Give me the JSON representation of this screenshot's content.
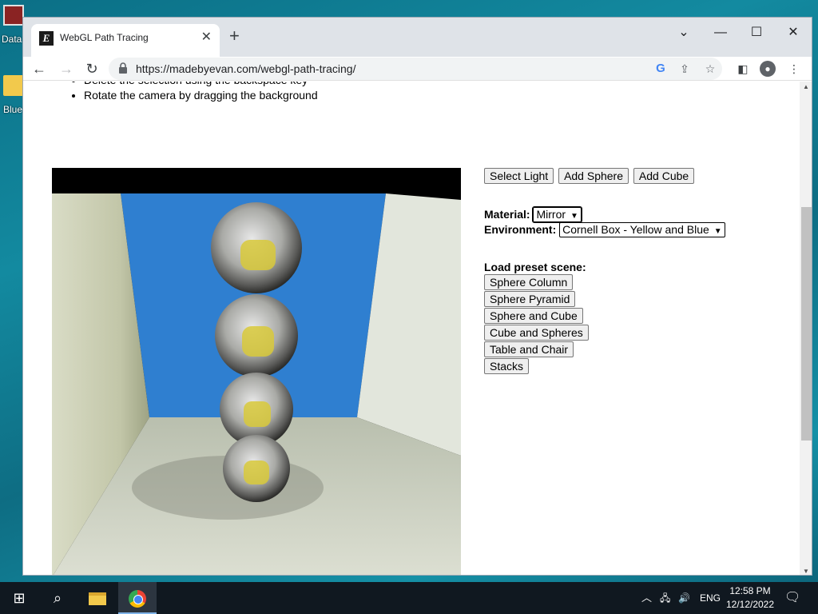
{
  "desktop": {
    "icons": [
      {
        "label": "Data"
      },
      {
        "label": "Blue"
      }
    ]
  },
  "browser": {
    "tab_title": "WebGL Path Tracing",
    "tab_favicon_letter": "E",
    "url": "https://madebyevan.com/webgl-path-tracing/"
  },
  "page": {
    "tips": [
      "Delete the selection using the backspace key",
      "Rotate the camera by dragging the background"
    ],
    "buttons": {
      "select_light": "Select Light",
      "add_sphere": "Add Sphere",
      "add_cube": "Add Cube"
    },
    "material_label": "Material:",
    "material_value": "Mirror",
    "environment_label": "Environment:",
    "environment_value": "Cornell Box - Yellow and Blue",
    "preset_label": "Load preset scene:",
    "presets": [
      "Sphere Column",
      "Sphere Pyramid",
      "Sphere and Cube",
      "Cube and Spheres",
      "Table and Chair",
      "Stacks"
    ]
  },
  "taskbar": {
    "language": "ENG",
    "time": "12:58 PM",
    "date": "12/12/2022"
  },
  "colors": {
    "back_wall": "#2f7fd0",
    "left_wall": "#d8dcc0",
    "right_wall": "#e4e8de",
    "floor": "#c9cfc3",
    "sphere_highlight": "#d8c93a"
  }
}
